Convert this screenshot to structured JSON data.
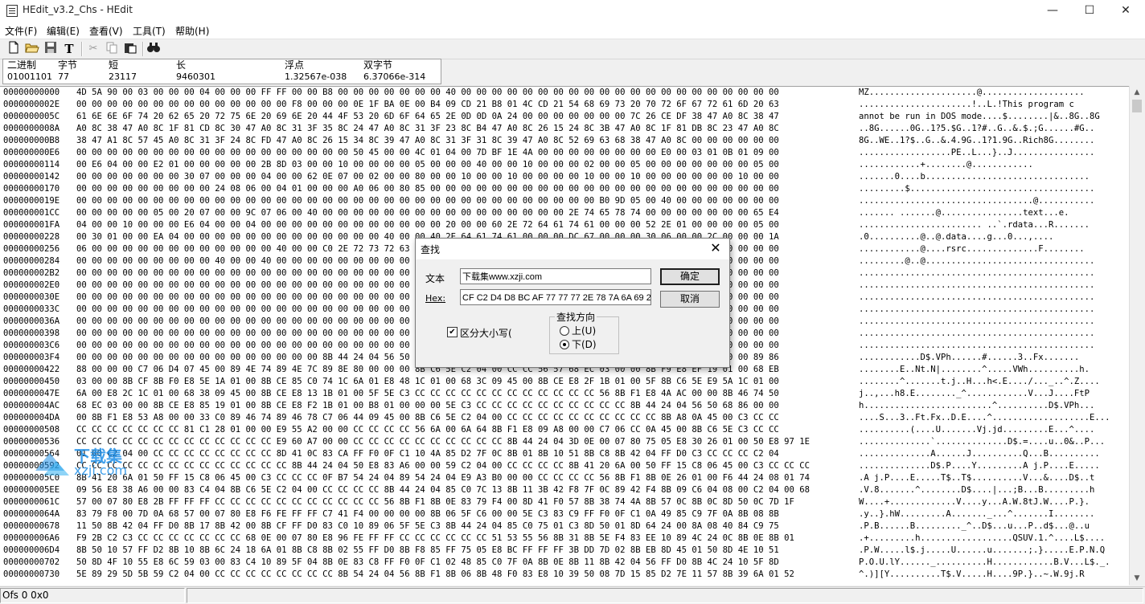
{
  "window": {
    "title": "HEdit_v3.2_Chs - HEdit",
    "minimize": "—",
    "maximize": "☐",
    "close": "✕"
  },
  "menu": [
    "文件(F)",
    "编辑(E)",
    "查看(V)",
    "工具(T)",
    "帮助(H)"
  ],
  "toolbar": [
    "new-icon",
    "open-icon",
    "save-icon",
    "text-icon",
    "cut-icon",
    "copy-icon",
    "paste-icon",
    "find-icon"
  ],
  "info": {
    "binary": {
      "label": "二进制",
      "value": "01001101"
    },
    "byte": {
      "label": "字节",
      "value": "77"
    },
    "short": {
      "label": "短",
      "value": "23117"
    },
    "long": {
      "label": "长",
      "value": "9460301"
    },
    "float": {
      "label": "浮点",
      "value": "1.32567e-038"
    },
    "double": {
      "label": "双字节",
      "value": "6.37066e-314"
    }
  },
  "hex_rows": [
    {
      "offset": "00000000000",
      "hex": "4D 5A 90 00 03 00 00 00 04 00 00 00 FF FF 00 00 B8 00 00 00 00 00 00 00 40 00 00 00 00 00 00 00 00 00 00 00 00 00 00 00 00 00 00 00 00 00",
      "ascii": "MZ.....................@...................."
    },
    {
      "offset": "0000000002E",
      "hex": "00 00 00 00 00 00 00 00 00 00 00 00 00 00 F8 00 00 00 0E 1F BA 0E 00 B4 09 CD 21 B8 01 4C CD 21 54 68 69 73 20 70 72 6F 67 72 61 6D 20 63",
      "ascii": "......................!..L.!This program c"
    },
    {
      "offset": "0000000005C",
      "hex": "61 6E 6E 6F 74 20 62 65 20 72 75 6E 20 69 6E 20 44 4F 53 20 6D 6F 64 65 2E 0D 0D 0A 24 00 00 00 00 00 00 00 7C 26 CE DF 38 47 A0 8C 38 47",
      "ascii": "annot be run in DOS mode....$........|&..8G..8G"
    },
    {
      "offset": "0000000008A",
      "hex": "A0 8C 38 47 A0 8C 1F 81 CD 8C 30 47 A0 8C 31 3F 35 8C 24 47 A0 8C 31 3F 23 8C B4 47 A0 8C 26 15 24 8C 3B 47 A0 8C 1F 81 DB 8C 23 47 A0 8C",
      "ascii": "..8G......0G..1?5.$G..1?#..G..&.$.;G......#G.."
    },
    {
      "offset": "000000000B8",
      "hex": "38 47 A1 8C 57 45 A0 8C 31 3F 24 8C FD 47 A0 8C 26 15 34 8C 39 47 A0 8C 31 3F 31 8C 39 47 A0 8C 52 69 63 68 38 47 A0 8C 00 00 00 00 00 00",
      "ascii": "8G..WE..1?$..G..&.4.9G..1?1.9G..Rich8G........"
    },
    {
      "offset": "000000000E6",
      "hex": "00 00 00 00 00 00 00 00 00 00 00 00 00 00 00 00 00 00 50 45 00 00 4C 01 04 00 7D BF 1E 4A 00 00 00 00 00 00 00 00 E0 00 03 01 0B 01 09 00",
      "ascii": "..................PE..L...}..J................"
    },
    {
      "offset": "00000000114",
      "hex": "00 E6 04 00 00 E2 01 00 00 00 00 00 2B 8D 03 00 00 10 00 00 00 00 05 00 00 00 40 00 00 10 00 00 00 02 00 00 05 00 00 00 00 00 00 00 05 00",
      "ascii": "............+........@............"
    },
    {
      "offset": "00000000142",
      "hex": "00 00 00 00 00 00 00 30 07 00 00 00 04 00 00 62 0E 07 00 02 00 00 80 00 00 10 00 00 10 00 00 00 00 10 00 00 10 00 00 00 00 00 00 10 00 00",
      "ascii": ".......0....b................................"
    },
    {
      "offset": "00000000170",
      "hex": "00 00 00 00 00 00 00 00 00 24 08 06 00 04 01 00 00 00 A0 06 00 80 85 00 00 00 00 00 00 00 00 00 00 00 00 00 00 00 00 00 00 00 00 00 00 00",
      "ascii": ".........$...................................."
    },
    {
      "offset": "0000000019E",
      "hex": "00 00 00 00 00 00 00 00 00 00 00 00 00 00 00 00 00 00 00 00 00 00 00 00 00 00 00 00 00 00 00 00 00 00 B0 9D 05 00 40 00 00 00 00 00 00 00",
      "ascii": "..................................@..........."
    },
    {
      "offset": "000000001CC",
      "hex": "00 00 00 00 00 05 00 20 07 00 00 9C 07 06 00 40 00 00 00 00 00 00 00 00 00 00 00 00 00 00 00 00 2E 74 65 78 74 00 00 00 00 00 00 00 65 E4",
      "ascii": "....... .......@................text...e."
    },
    {
      "offset": "000000001FA",
      "hex": "04 00 00 10 00 00 00 E6 04 00 00 04 00 00 00 00 00 00 00 00 00 00 00 00 20 00 00 60 2E 72 64 61 74 61 00 00 00 52 2E 01 00 00 00 00 05 00",
      "ascii": "........................ ..`.rdata...R......."
    },
    {
      "offset": "00000000228",
      "hex": "00 30 01 00 00 EA 04 00 00 00 00 00 00 00 00 00 00 00 00 00 40 00 00 40 2E 64 61 74 61 00 00 00 DC 67 00 00 00 30 06 00 00 2C 00 00 00 1A",
      "ascii": ".0..........@..@.data....g...0...,...."
    },
    {
      "offset": "00000000256",
      "hex": "06 00 00 00 00 00 00 00 00 00 00 00 00 40 00 00 C0 2E 72 73 72 63 00 00 00 00 00 00 00 00 00 00 00 00 00 00 00 00 00 00 46 06 00 00 00 00",
      "ascii": "............@....rsrc..............F........"
    },
    {
      "offset": "00000000284",
      "hex": "00 00 00 00 00 00 00 00 00 40 00 00 40 00 00 00 00 00 00 00 00 00 00 00 00 00 00 00 00 00 00 00 00 00 00 00 00 00 00 00 00 00 00 00 00 00",
      "ascii": ".........@..@................................."
    },
    {
      "offset": "000000002B2",
      "hex": "00 00 00 00 00 00 00 00 00 00 00 00 00 00 00 00 00 00 00 00 00 00 00 00 00 00 00 00 00 00 00 00 00 00 00 00 00 00 00 00 00 00 00 00 00 00",
      "ascii": ".............................................."
    },
    {
      "offset": "000000002E0",
      "hex": "00 00 00 00 00 00 00 00 00 00 00 00 00 00 00 00 00 00 00 00 00 00 00 00 00 00 00 00 00 00 00 00 00 00 00 00 00 00 00 00 00 00 00 00 00 00",
      "ascii": ".............................................."
    },
    {
      "offset": "0000000030E",
      "hex": "00 00 00 00 00 00 00 00 00 00 00 00 00 00 00 00 00 00 00 00 00 00 00 00 00 00 00 00 00 00 00 00 00 00 00 00 00 00 00 00 00 00 00 00 00 00",
      "ascii": ".............................................."
    },
    {
      "offset": "0000000033C",
      "hex": "00 00 00 00 00 00 00 00 00 00 00 00 00 00 00 00 00 00 00 00 00 00 00 00 00 00 00 00 00 00 00 00 00 00 00 00 00 00 00 00 00 00 00 00 00 00",
      "ascii": ".............................................."
    },
    {
      "offset": "0000000036A",
      "hex": "00 00 00 00 00 00 00 00 00 00 00 00 00 00 00 00 00 00 00 00 00 00 00 00 00 00 00 00 00 00 00 00 00 00 00 00 00 00 00 00 00 00 00 00 00 00",
      "ascii": ".............................................."
    },
    {
      "offset": "00000000398",
      "hex": "00 00 00 00 00 00 00 00 00 00 00 00 00 00 00 00 00 00 00 00 00 00 00 00 00 00 00 00 00 00 00 00 00 00 00 00 00 00 00 00 00 00 00 00 00 00",
      "ascii": ".............................................."
    },
    {
      "offset": "000000003C6",
      "hex": "00 00 00 00 00 00 00 00 00 00 00 00 00 00 00 00 00 00 00 00 00 00 00 00 00 00 00 00 00 00 00 00 00 00 00 00 00 00 00 00 00 00 00 00 00 00",
      "ascii": ".............................................."
    },
    {
      "offset": "000000003F4",
      "hex": "00 00 00 00 00 00 00 00 00 00 00 00 00 00 00 00 8B 44 24 04 56 50 68 85 00 00 00 00 00 00 00 00 00 00 00 00 00 00 00 00 86 84 00 00 89 86",
      "ascii": "............D$.VPh......#......3..Fx......."
    },
    {
      "offset": "00000000422",
      "hex": "88 00 00 00 C7 06 D4 07 45 00 89 4E 74 89 4E 7C 89 8E 80 00 00 00 8B C6 5E C2 04 00 CC CC 56 57 68 EC 03 00 00 8B F9 E8 EF 19 01 00 68 EB",
      "ascii": "........E..Nt.N|........^.....VWh..........h."
    },
    {
      "offset": "00000000450",
      "hex": "03 00 00 8B CF 8B F0 E8 5E 1A 01 00 8B CE 85 C0 74 1C 6A 01 E8 48 1C 01 00 68 3C 09 45 00 8B CE E8 2F 1B 01 00 5F 8B C6 5E E9 5A 1C 01 00",
      "ascii": "........^.......t.j..H...h<.E..../..._..^.Z...."
    },
    {
      "offset": "0000000047E",
      "hex": "6A 00 E8 2C 1C 01 00 68 38 09 45 00 8B CE E8 13 1B 01 00 5F 5E C3 CC CC CC CC CC CC CC CC CC CC CC CC 56 8B F1 E8 4A AC 00 00 8B 46 74 50",
      "ascii": "j..,...h8.E........_^............V...J....FtP"
    },
    {
      "offset": "000000004AC",
      "hex": "68 EC 03 00 00 8B CE E8 85 19 01 00 8B CE E8 F2 1B 01 00 B8 01 00 00 00 5E C3 CC CC CC CC CC CC CC CC CC CC 8B 44 24 04 56 50 68 86 00 00",
      "ascii": "h.........................^..........D$.VPh..."
    },
    {
      "offset": "000000004DA",
      "hex": "00 8B F1 E8 53 A8 00 00 33 C0 89 46 74 89 46 78 C7 06 44 09 45 00 8B C6 5E C2 04 00 CC CC CC CC CC CC CC CC CC CC 8B A8 0A 45 00 C3 CC CC",
      "ascii": "....S...3..Ft.Fx..D.E....^...................E..."
    },
    {
      "offset": "00000000508",
      "hex": "CC CC CC CC CC CC CC 81 C1 28 01 00 00 E9 55 A2 00 00 CC CC CC CC 56 6A 00 6A 64 8B F1 E8 09 A8 00 00 C7 06 CC 0A 45 00 8B C6 5E C3 CC CC",
      "ascii": "..........(....U.......Vj.jd.........E...^...."
    },
    {
      "offset": "00000000536",
      "hex": "CC CC CC CC CC CC CC CC CC CC CC CC CC E9 60 A7 00 00 CC CC CC CC CC CC CC CC CC CC 8B 44 24 04 3D 0E 00 07 80 75 05 E8 30 26 01 00 50 E8 97 1E",
      "ascii": "..............`..............D$.=....u..0&..P..."
    },
    {
      "offset": "00000000564",
      "hex": "01 00 C2 04 00 CC CC CC CC CC CC CC CC 8D 41 0C 83 CA FF F0 0F C1 10 4A 85 D2 7F 0C 8B 01 8B 10 51 8B C8 8B 42 04 FF D0 C3 CC CC CC C2 04",
      "ascii": "..............A......J..........Q...B.........."
    },
    {
      "offset": "00000000592",
      "hex": "CC CC CC CC CC CC CC CC CC CC CC CC CC CC 8B 44 24 04 50 E8 83 A6 00 00 59 C2 04 00 CC CC CC CC 8B 41 20 6A 00 50 FF 15 C8 06 45 00 C3 CC CC CC",
      "ascii": "..............D$.P....Y.........A j.P....E....."
    },
    {
      "offset": "000000005C0",
      "hex": "8B 41 20 6A 01 50 FF 15 C8 06 45 00 C3 CC CC CC 0F B7 54 24 04 89 54 24 04 E9 A3 B0 00 00 CC CC CC CC 56 8B F1 8B 0E 26 01 00 F6 44 24 08 01 74",
      "ascii": ".A j.P....E.....T$..T$..........V...&....D$..t"
    },
    {
      "offset": "000000005EE",
      "hex": "09 56 E8 38 A6 00 00 83 C4 04 8B C6 5E C2 04 00 CC CC CC CC 8B 44 24 04 85 C0 7C 13 8B 11 3B 42 F8 7F 0C 89 42 F4 8B 09 C6 04 08 00 C2 04 00 68",
      "ascii": ".V.8.......^........D$....|...;B...B.........h"
    },
    {
      "offset": "0000000061C",
      "hex": "57 00 07 80 E8 2B FF FF FF CC CC CC CC CC CC CC CC CC CC CC 56 8B F1 8B 0E 83 79 F4 00 8D 41 F0 57 8B 38 74 4A 8B 57 0C 8B 0C 8D 50 0C 7D 1F",
      "ascii": "W....+.............V....y...A.W.8tJ.W....P.}."
    },
    {
      "offset": "0000000064A",
      "hex": "83 79 F8 00 7D 0A 68 57 00 07 80 E8 F6 FE FF FF C7 41 F4 00 00 00 00 8B 06 5F C6 00 00 5E C3 83 C9 FF F0 0F C1 0A 49 85 C9 7F 0A 8B 08 8B",
      "ascii": ".y..}.hW.........A......._...^.......I........"
    },
    {
      "offset": "00000000678",
      "hex": "11 50 8B 42 04 FF D0 8B 17 8B 42 00 8B CF FF D0 83 C0 10 89 06 5F 5E C3 8B 44 24 04 85 C0 75 01 C3 8D 50 01 8D 64 24 00 8A 08 40 84 C9 75",
      "ascii": ".P.B......B........._^..D$...u...P..d$...@..u"
    },
    {
      "offset": "000000006A6",
      "hex": "F9 2B C2 C3 CC CC CC CC CC CC CC 68 0E 00 07 80 E8 96 FE FF FF CC CC CC CC CC CC 51 53 55 56 8B 31 8B 5E F4 83 EE 10 89 4C 24 0C 8B 0E 8B 01",
      "ascii": ".+.........h..................QSUV.1.^....L$...."
    },
    {
      "offset": "000000006D4",
      "hex": "8B 50 10 57 FF D2 8B 10 8B 6C 24 18 6A 01 8B C8 8B 02 55 FF D0 8B F8 85 FF 75 05 E8 BC FF FF FF 3B DD 7D 02 8B EB 8D 45 01 50 8D 4E 10 51",
      "ascii": ".P.W.....l$.j.....U......u.......;.}.....E.P.N.Q"
    },
    {
      "offset": "00000000702",
      "hex": "50 8D 4F 10 55 E8 6C 59 03 00 83 C4 10 89 5F 04 8B 0E 83 C8 FF F0 0F C1 02 48 85 C0 7F 0A 8B 0E 8B 11 8B 42 04 56 FF D0 8B 4C 24 10 5F 8D",
      "ascii": "P.O.U.lY......_..........H............B.V...L$._."
    },
    {
      "offset": "00000000730",
      "hex": "5E 89 29 5D 5B 59 C2 04 00 CC CC CC CC CC CC CC CC 8B 54 24 04 56 8B F1 8B 06 8B 48 F0 83 E8 10 39 50 08 7D 15 85 D2 7E 11 57 8B 39 6A 01 52",
      "ascii": "^.)][Y..........T$.V.....H....9P.}..~.W.9j.R"
    }
  ],
  "status": {
    "offset": "Ofs 0  0x0",
    "extra": ""
  },
  "find_dialog": {
    "title": "查找",
    "text_label": "文本",
    "text_value": "下载集www.xzji.com",
    "hex_label": "Hex:",
    "hex_value": "CF C2 D4 D8 BC AF 77 77 77 2E 78 7A 6A 69 2E",
    "ok": "确定",
    "cancel": "取消",
    "match_case": "区分大小写(",
    "match_case_checked": true,
    "direction_title": "查找方向",
    "up": "上(U)",
    "down": "下(D)",
    "direction_selected": "down"
  },
  "watermark": {
    "brand": "下载集",
    "url": "xzji.com",
    "color": "#1e8fe8"
  }
}
